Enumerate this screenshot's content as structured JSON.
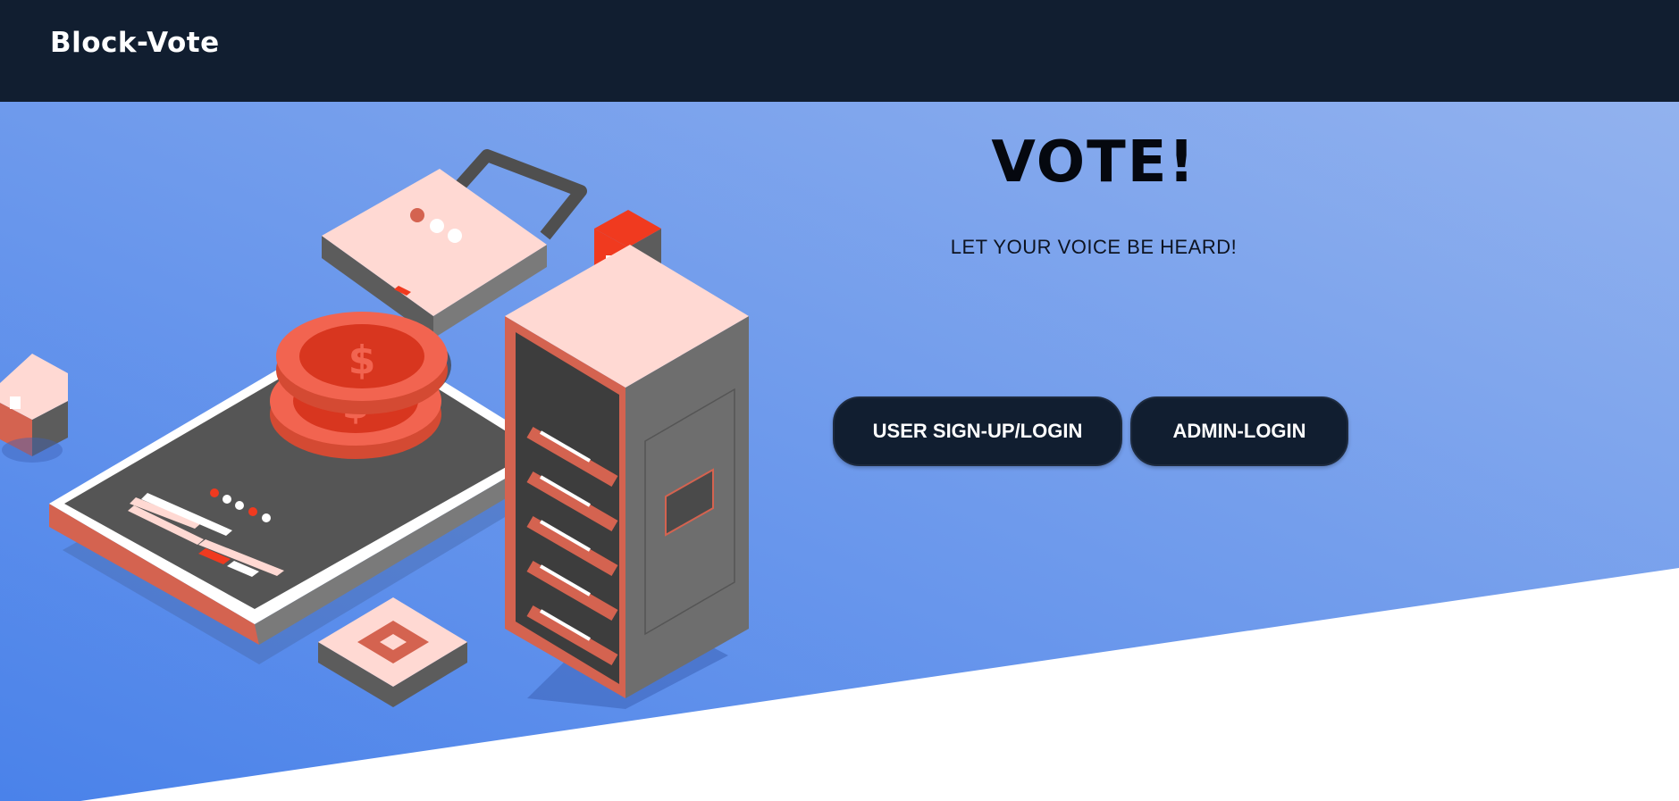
{
  "header": {
    "brand": "Block-Vote",
    "background": "#111e30"
  },
  "hero": {
    "headline": "VOTE!",
    "tagline": "LET YOUR VOICE BE HEARD!",
    "gradient_start": "#4a82ea",
    "gradient_end": "#92b2ee",
    "buttons": {
      "user_login": "USER SIGN-UP/LOGIN",
      "admin_login": "ADMIN-LOGIN"
    }
  },
  "illustration": {
    "icons": [
      "cube-icon",
      "smartphone-icon",
      "coin-stack-icon",
      "padlock-icon",
      "server-rack-icon",
      "chip-icon"
    ],
    "accent_colors": [
      "#f03a1f",
      "#ffd9d3",
      "#5a5a5a",
      "#d46350"
    ]
  }
}
